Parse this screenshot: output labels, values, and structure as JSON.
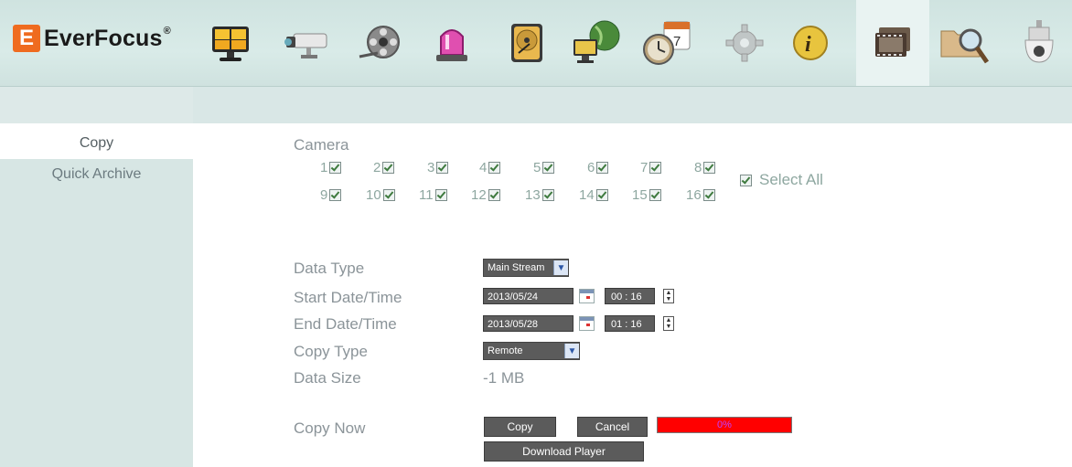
{
  "brand": {
    "name": "EverFocus",
    "mark": "E"
  },
  "nav": {
    "icons": [
      {
        "name": "live-view-icon"
      },
      {
        "name": "camera-icon"
      },
      {
        "name": "playback-icon"
      },
      {
        "name": "alarm-icon"
      },
      {
        "name": "hdd-icon"
      },
      {
        "name": "network-icon"
      },
      {
        "name": "schedule-icon"
      },
      {
        "name": "settings-icon"
      },
      {
        "name": "info-icon"
      },
      {
        "name": "archive-icon"
      },
      {
        "name": "search-icon"
      },
      {
        "name": "ptz-dome-icon"
      }
    ]
  },
  "sidebar": {
    "items": [
      {
        "label": "Copy",
        "active": true
      },
      {
        "label": "Quick Archive",
        "active": false
      }
    ]
  },
  "camera": {
    "label": "Camera",
    "channels": [
      "1",
      "2",
      "3",
      "4",
      "5",
      "6",
      "7",
      "8",
      "9",
      "10",
      "11",
      "12",
      "13",
      "14",
      "15",
      "16"
    ],
    "select_all": "Select All"
  },
  "form": {
    "data_type": {
      "label": "Data Type",
      "value": "Main Stream"
    },
    "start": {
      "label": "Start Date/Time",
      "date": "2013/05/24",
      "time": "00 : 16"
    },
    "end": {
      "label": "End Date/Time",
      "date": "2013/05/28",
      "time": "01 : 16"
    },
    "copy_type": {
      "label": "Copy Type",
      "value": "Remote"
    },
    "data_size": {
      "label": "Data Size",
      "value": "-1 MB"
    },
    "copy_now": {
      "label": "Copy Now"
    }
  },
  "buttons": {
    "copy": "Copy",
    "cancel": "Cancel",
    "download": "Download Player"
  },
  "progress": {
    "text": "0%",
    "value": 0
  },
  "colors": {
    "accent": "#ef6b1f",
    "header": "#d4e6e3",
    "sidebar": "#d7e6e4",
    "progress": "#ff0000"
  }
}
